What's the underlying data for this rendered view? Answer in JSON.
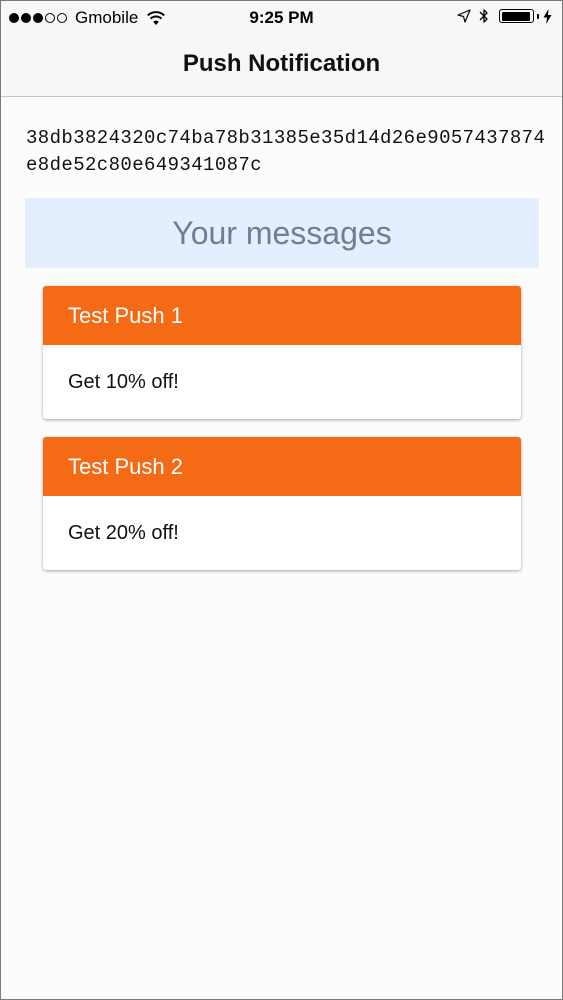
{
  "status_bar": {
    "carrier": "Gmobile",
    "time": "9:25 PM",
    "signal_filled": 3,
    "signal_total": 5,
    "battery_level": 0.96,
    "icons": [
      "wifi-icon",
      "location-arrow-icon",
      "bluetooth-icon",
      "battery-icon",
      "charging-bolt-icon"
    ]
  },
  "nav": {
    "title": "Push Notification"
  },
  "device_token": "38db3824320c74ba78b31385e35d14d26e9057437874e8de52c80e649341087c",
  "messages": {
    "title": "Your messages",
    "items": [
      {
        "title": "Test Push 1",
        "body": "Get 10% off!"
      },
      {
        "title": "Test Push 2",
        "body": "Get 20% off!"
      }
    ]
  },
  "colors": {
    "accent": "#f56a15",
    "messages_header_bg": "#e3efff",
    "messages_header_text": "#6f7e90"
  }
}
